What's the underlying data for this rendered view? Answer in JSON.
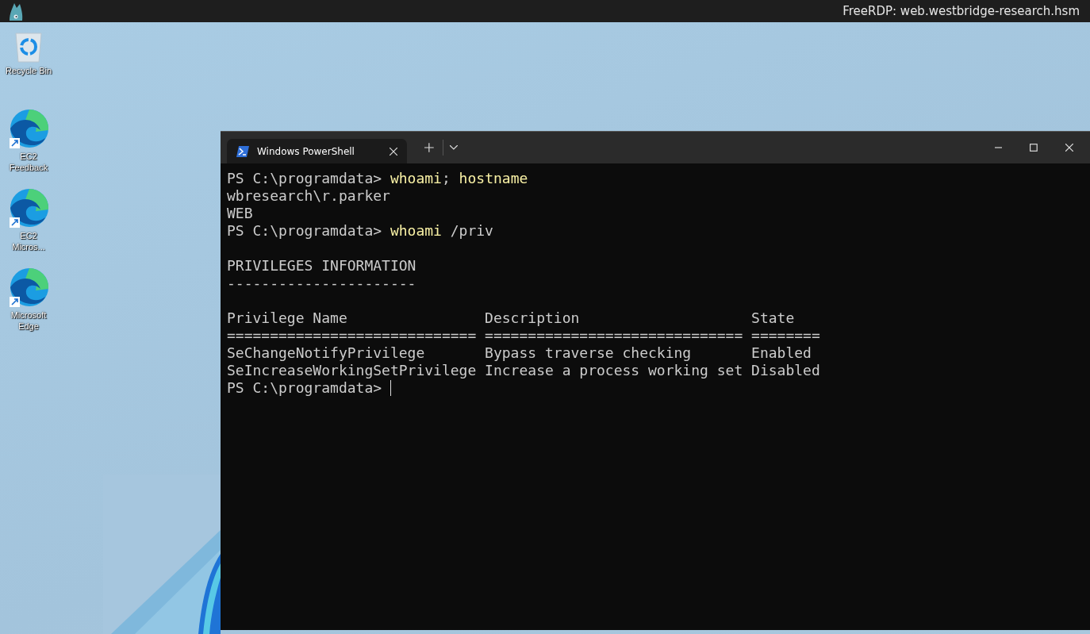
{
  "remote_session": {
    "title": "FreeRDP: web.westbridge-research.hsm"
  },
  "desktop_icons": [
    {
      "label": "Recycle Bin",
      "kind": "recycle"
    },
    {
      "label": "EC2 Feedback",
      "kind": "shortcut"
    },
    {
      "label": "EC2 Micros...",
      "kind": "shortcut"
    },
    {
      "label": "Microsoft Edge",
      "kind": "shortcut"
    }
  ],
  "terminal": {
    "tabs": [
      {
        "label": "Windows PowerShell",
        "selected": true
      }
    ],
    "blocks": [
      {
        "lines": [
          [
            {
              "text": "PS C:\\programdata> ",
              "kind": "plain"
            },
            {
              "text": "whoami",
              "kind": "command"
            },
            {
              "text": ";",
              "kind": "plain"
            },
            {
              "text": " hostname",
              "kind": "command"
            }
          ],
          [
            {
              "text": "wbresearch\\r.parker",
              "kind": "plain"
            }
          ],
          [
            {
              "text": "WEB",
              "kind": "plain"
            }
          ],
          [
            {
              "text": "PS C:\\programdata> ",
              "kind": "plain"
            },
            {
              "text": "whoami",
              "kind": "command"
            },
            {
              "text": " /priv",
              "kind": "plain"
            }
          ]
        ]
      },
      {
        "lines": [
          [
            {
              "text": "PRIVILEGES INFORMATION",
              "kind": "plain"
            }
          ],
          [
            {
              "text": "----------------------",
              "kind": "plain"
            }
          ]
        ]
      },
      {
        "lines": [
          [
            {
              "text": "Privilege Name                Description                    State",
              "kind": "plain"
            }
          ],
          [
            {
              "text": "============================= ============================== ========",
              "kind": "plain"
            }
          ],
          [
            {
              "text": "SeChangeNotifyPrivilege       Bypass traverse checking       Enabled",
              "kind": "plain"
            }
          ],
          [
            {
              "text": "SeIncreaseWorkingSetPrivilege Increase a process working set Disabled",
              "kind": "plain"
            }
          ],
          [
            {
              "text": "PS C:\\programdata> ",
              "kind": "plain"
            }
          ]
        ]
      }
    ]
  }
}
